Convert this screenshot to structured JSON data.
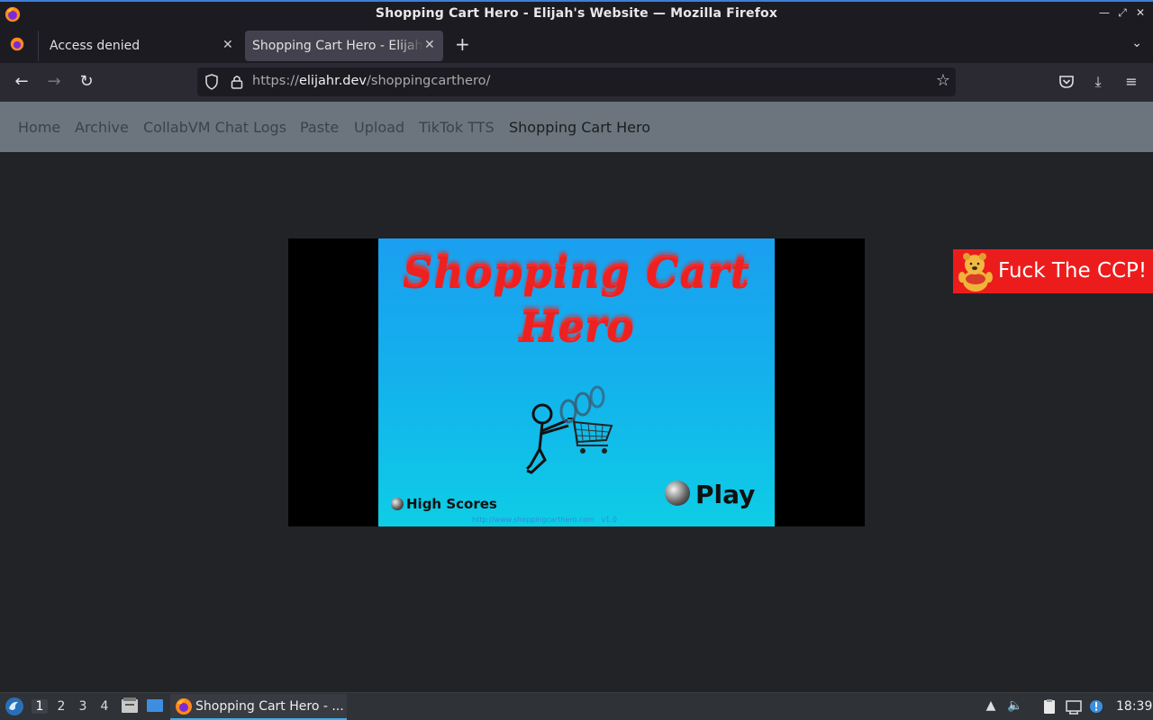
{
  "window": {
    "title": "Shopping Cart Hero - Elijah's Website — Mozilla Firefox"
  },
  "tabs": [
    {
      "label": "Access denied"
    },
    {
      "label": "Shopping Cart Hero - Elijah's Website"
    }
  ],
  "urlbar": {
    "scheme": "https://",
    "host": "elijahr.dev",
    "path": "/shoppingcarthero/"
  },
  "sitenav": {
    "items": [
      "Home",
      "Archive",
      "CollabVM Chat Logs",
      "Paste",
      "Upload",
      "TikTok TTS",
      "Shopping Cart Hero"
    ]
  },
  "game": {
    "title_line1": "Shopping Cart",
    "title_line2": "Hero",
    "high_scores_label": "High Scores",
    "play_label": "Play",
    "footer_link": "http://www.shoppingcarthero.com    v1.0"
  },
  "banner": {
    "text": "Fuck The CCP!"
  },
  "taskbar": {
    "workspaces": [
      "1",
      "2",
      "3",
      "4"
    ],
    "task_label": "Shopping Cart Hero - ...",
    "clock": "18:39"
  },
  "colors": {
    "accent": "#3daee9",
    "banner": "#ed1c1c",
    "game_title": "#ee2020"
  }
}
